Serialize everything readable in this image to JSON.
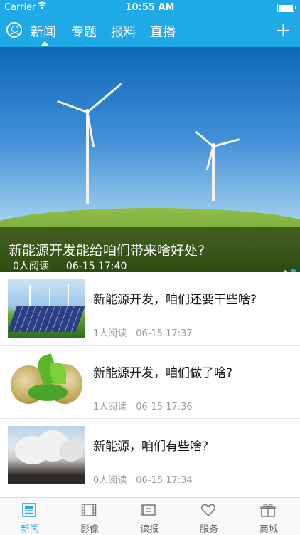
{
  "status_bar": {
    "carrier": "Carrier",
    "time": "10:55 AM"
  },
  "nav": {
    "tabs": [
      "新闻",
      "专题",
      "报料",
      "直播"
    ],
    "active_tab": "新闻"
  },
  "banner": {
    "title": "新能源开发能给咱们带来啥好处?",
    "reads": "0人阅读",
    "time": "06-15 17:40",
    "pages": 2,
    "active_page": 2
  },
  "news": [
    {
      "title": "新能源开发，咱们还要干些啥?",
      "reads": "1人阅读",
      "time": "06-15 17:37"
    },
    {
      "title": "新能源开发，咱们做了啥?",
      "reads": "1人阅读",
      "time": "06-15 17:36"
    },
    {
      "title": "新能源，咱们有些啥?",
      "reads": "0人阅读",
      "time": "06-15 17:34"
    }
  ],
  "tabbar": {
    "items": [
      {
        "label": "新闻",
        "icon": "newspaper-icon"
      },
      {
        "label": "影像",
        "icon": "film-icon"
      },
      {
        "label": "读报",
        "icon": "read-paper-icon"
      },
      {
        "label": "服务",
        "icon": "heart-icon"
      },
      {
        "label": "商城",
        "icon": "gift-icon"
      }
    ],
    "active": "新闻"
  },
  "colors": {
    "accent": "#1fa9e6",
    "text_secondary": "#9a9a9a"
  }
}
